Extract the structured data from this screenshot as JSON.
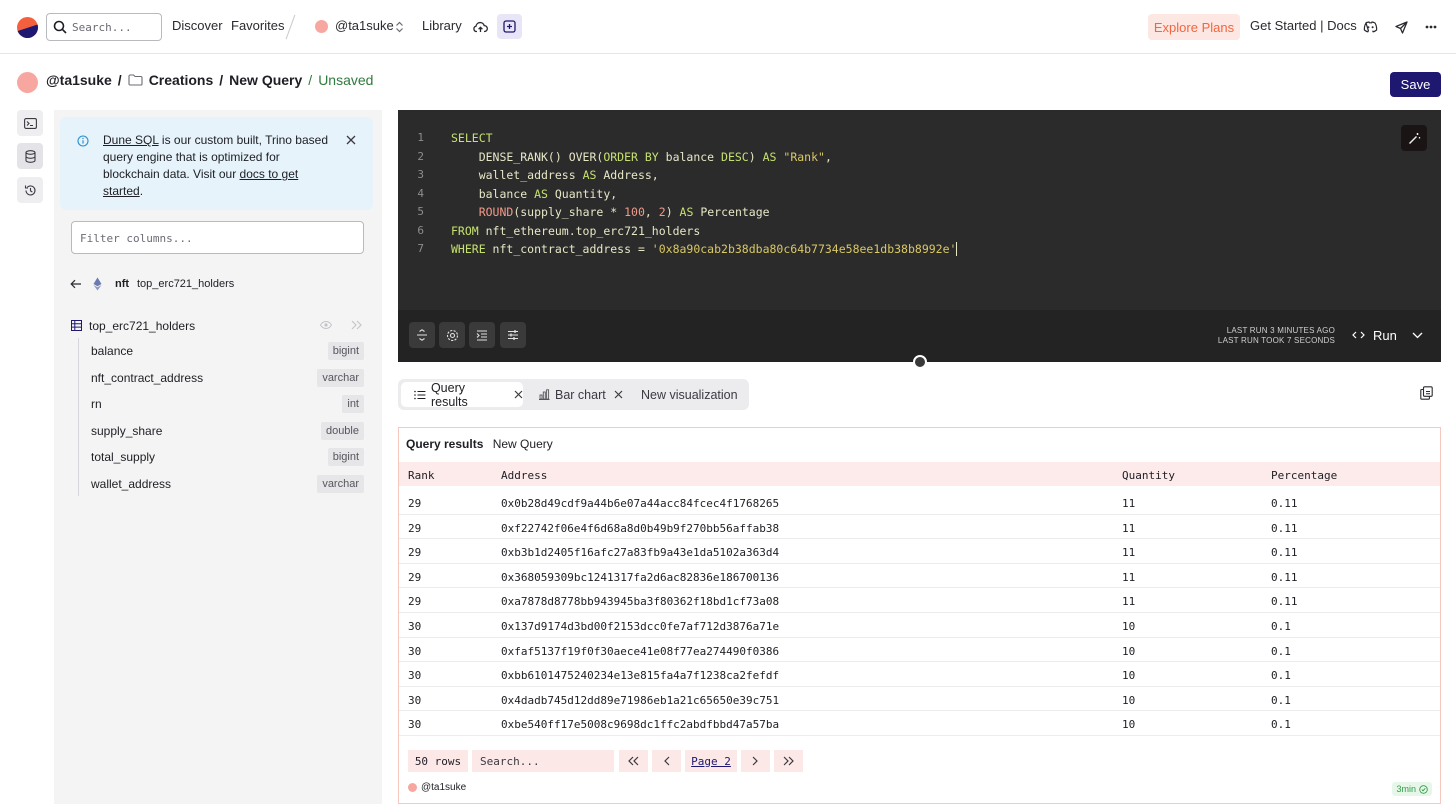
{
  "topbar": {
    "search_placeholder": "Search...",
    "nav": [
      "Discover",
      "Favorites"
    ],
    "user": "@ta1suke",
    "library": "Library",
    "explore_plans": "Explore Plans",
    "get_started": "Get Started | Docs"
  },
  "breadcrumb": {
    "user": "@ta1suke",
    "sep1": "/",
    "folder": "Creations",
    "sep2": "/",
    "query": "New Query",
    "sep3": "/",
    "status": "Unsaved",
    "save_label": "Save"
  },
  "sidebar": {
    "info": {
      "link1": "Dune SQL",
      "text1": " is our custom built, Trino based query engine that is optimized for blockchain data. Visit our ",
      "link2": "docs to get started",
      "text2": "."
    },
    "filter_placeholder": "Filter columns...",
    "schema": "nft",
    "table_breadcrumb": "top_erc721_holders",
    "table_name": "top_erc721_holders",
    "columns": [
      {
        "name": "balance",
        "type": "bigint"
      },
      {
        "name": "nft_contract_address",
        "type": "varchar"
      },
      {
        "name": "rn",
        "type": "int"
      },
      {
        "name": "supply_share",
        "type": "double"
      },
      {
        "name": "total_supply",
        "type": "bigint"
      },
      {
        "name": "wallet_address",
        "type": "varchar"
      }
    ]
  },
  "editor": {
    "line_numbers": [
      "1",
      "2",
      "3",
      "4",
      "5",
      "6",
      "7"
    ],
    "last_run": "LAST RUN 3 MINUTES AGO",
    "last_run_took": "LAST RUN TOOK 7 SECONDS",
    "run_label": "Run"
  },
  "tabs": [
    {
      "label": "Query results",
      "active": true
    },
    {
      "label": "Bar chart",
      "active": false
    },
    {
      "label": "New visualization",
      "active": false
    }
  ],
  "results": {
    "title": "Query results",
    "query_name": "New Query",
    "columns": [
      "Rank",
      "Address",
      "Quantity",
      "Percentage"
    ],
    "rows": [
      [
        "29",
        "0x0b28d49cdf9a44b6e07a44acc84fcec4f1768265",
        "11",
        "0.11"
      ],
      [
        "29",
        "0xf22742f06e4f6d68a8d0b49b9f270bb56affab38",
        "11",
        "0.11"
      ],
      [
        "29",
        "0xb3b1d2405f16afc27a83fb9a43e1da5102a363d4",
        "11",
        "0.11"
      ],
      [
        "29",
        "0x368059309bc1241317fa2d6ac82836e186700136",
        "11",
        "0.11"
      ],
      [
        "29",
        "0xa7878d8778bb943945ba3f80362f18bd1cf73a08",
        "11",
        "0.11"
      ],
      [
        "30",
        "0x137d9174d3bd00f2153dcc0fe7af712d3876a71e",
        "10",
        "0.1"
      ],
      [
        "30",
        "0xfaf5137f19f0f30aece41e08f77ea274490f0386",
        "10",
        "0.1"
      ],
      [
        "30",
        "0xbb6101475240234e13e815fa4a7f1238ca2fefdf",
        "10",
        "0.1"
      ],
      [
        "30",
        "0x4dadb745d12dd89e71986eb1a21c65650e39c751",
        "10",
        "0.1"
      ],
      [
        "30",
        "0xbe540ff17e5008c9698dc1ffc2abdfbbd47a57ba",
        "10",
        "0.1"
      ]
    ],
    "row_count": "50 rows",
    "search_placeholder": "Search...",
    "page_label": "Page 2",
    "owner": "@ta1suke",
    "age": "3min"
  },
  "colors": {
    "brand_navy": "#1e1870",
    "accent_orange": "#f26640",
    "editor_bg": "#2b2b2b",
    "keyword": "#c6e16f",
    "string": "#d9c864"
  }
}
